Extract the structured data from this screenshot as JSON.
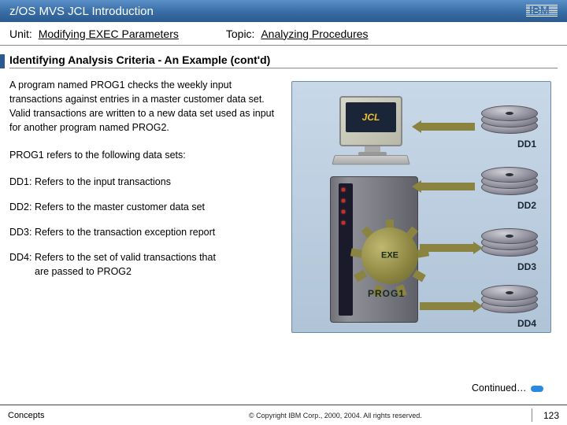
{
  "header": {
    "title": "z/OS MVS JCL Introduction",
    "logo_text": "IBM"
  },
  "subheader": {
    "unit_label": "Unit:",
    "unit_value": "Modifying EXEC Parameters",
    "topic_label": "Topic:",
    "topic_value": "Analyzing Procedures"
  },
  "section_title": "Identifying Analysis Criteria - An Example (cont'd)",
  "body": {
    "intro": "A program named PROG1 checks the weekly input transactions against entries in a master customer data set. Valid transactions are written to a new data set used as input for another program named PROG2.",
    "refers": "PROG1 refers to the following data sets:",
    "dd1": "DD1: Refers to the input transactions",
    "dd2": "DD2: Refers to the master customer data set",
    "dd3": "DD3: Refers to the transaction exception report",
    "dd4_a": "DD4: Refers to the set of valid transactions that",
    "dd4_b": "are passed to PROG2"
  },
  "diagram": {
    "monitor_label": "JCL",
    "gear_label": "EXE",
    "prog_label": "PROG1",
    "disks": [
      "DD1",
      "DD2",
      "DD3",
      "DD4"
    ]
  },
  "continued": "Continued…",
  "footer": {
    "left": "Concepts",
    "center": "© Copyright IBM Corp., 2000, 2004. All rights reserved.",
    "page": "123"
  }
}
